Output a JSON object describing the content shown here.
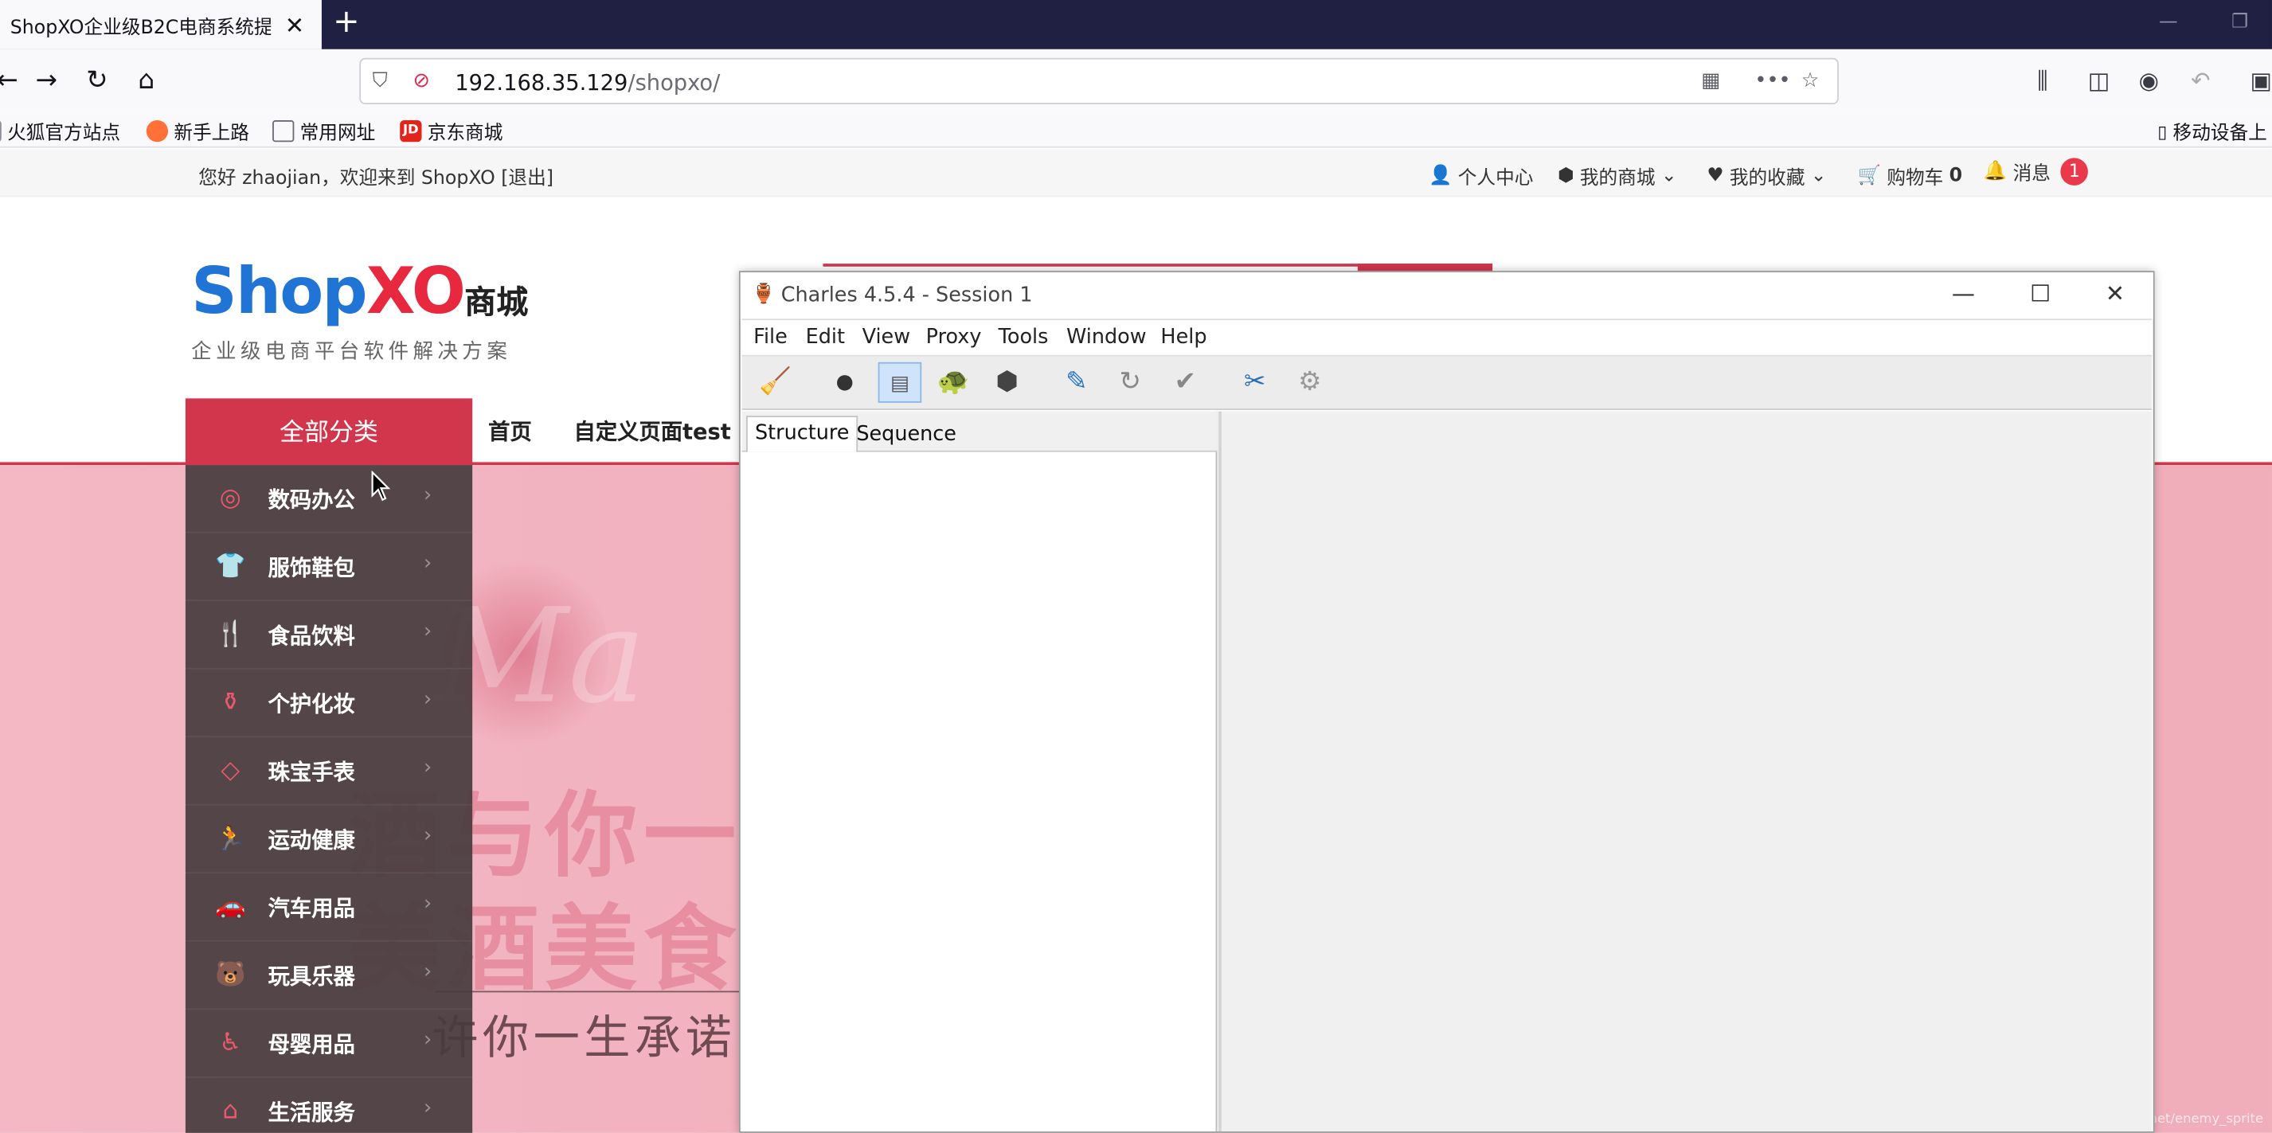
{
  "browser": {
    "tab_title": "ShopXO企业级B2C电商系统提",
    "tab_close": "✕",
    "new_tab": "+",
    "url_host": "192.168.35.129",
    "url_path": "/shopxo/",
    "bookmarks": [
      {
        "label": "火狐官方站点",
        "color": "#e66000"
      },
      {
        "label": "新手上路",
        "color": "#ff7139"
      },
      {
        "label": "常用网址",
        "color": "#8f8f9d"
      },
      {
        "label": "京东商城",
        "color": "#e1251b"
      }
    ],
    "bookmarks_right": "移动设备上",
    "jd_badge": "JD"
  },
  "page": {
    "welcome": "您好 zhaojian，欢迎来到 ShopXO [退出]",
    "top_nav": [
      {
        "icon": "user-icon",
        "label": "个人中心"
      },
      {
        "icon": "cube-icon",
        "label": "我的商城"
      },
      {
        "icon": "heart-icon",
        "label": "我的收藏"
      },
      {
        "icon": "cart-icon",
        "label": "购物车",
        "count": "0"
      },
      {
        "icon": "bell-icon",
        "label": "消息",
        "badge": "1"
      }
    ],
    "logo": {
      "shop": "Shop",
      "xo": "XO",
      "cn": "商城",
      "subtitle": "企业级电商平台软件解决方案"
    },
    "all_categories": "全部分类",
    "main_nav": [
      "首页",
      "自定义页面test"
    ],
    "categories": [
      {
        "label": "数码办公",
        "icon": "camera-icon"
      },
      {
        "label": "服饰鞋包",
        "icon": "shirt-icon"
      },
      {
        "label": "食品饮料",
        "icon": "cutlery-icon"
      },
      {
        "label": "个护化妆",
        "icon": "cosmetics-icon"
      },
      {
        "label": "珠宝手表",
        "icon": "diamond-icon"
      },
      {
        "label": "运动健康",
        "icon": "runner-icon"
      },
      {
        "label": "汽车用品",
        "icon": "car-icon"
      },
      {
        "label": "玩具乐器",
        "icon": "bear-icon"
      },
      {
        "label": "母婴用品",
        "icon": "stroller-icon"
      },
      {
        "label": "生活服务",
        "icon": "house-icon"
      }
    ],
    "banner": {
      "line1": "酒与你一",
      "line2": "美酒美食有",
      "line3": "许你一生承诺",
      "script": "Ma"
    },
    "watermark": "https://blog.csdn.net/enemy_sprite"
  },
  "charles": {
    "title": "Charles 4.5.4 - Session 1",
    "menu": [
      "File",
      "Edit",
      "View",
      "Proxy",
      "Tools",
      "Window",
      "Help"
    ],
    "tools": [
      {
        "name": "broom-icon",
        "glyph": "🧹"
      },
      {
        "name": "record-icon",
        "glyph": "●"
      },
      {
        "name": "throttle-icon",
        "glyph": "▤"
      },
      {
        "name": "turtle-icon",
        "glyph": "🐢"
      },
      {
        "name": "stop-icon",
        "glyph": "⬢"
      },
      {
        "name": "pen-icon",
        "glyph": "✎"
      },
      {
        "name": "refresh-icon",
        "glyph": "↻"
      },
      {
        "name": "check-icon",
        "glyph": "✔"
      },
      {
        "name": "tools-icon",
        "glyph": "✂"
      },
      {
        "name": "settings-icon",
        "glyph": "⚙"
      }
    ],
    "tabs": [
      "Structure",
      "Sequence"
    ]
  }
}
